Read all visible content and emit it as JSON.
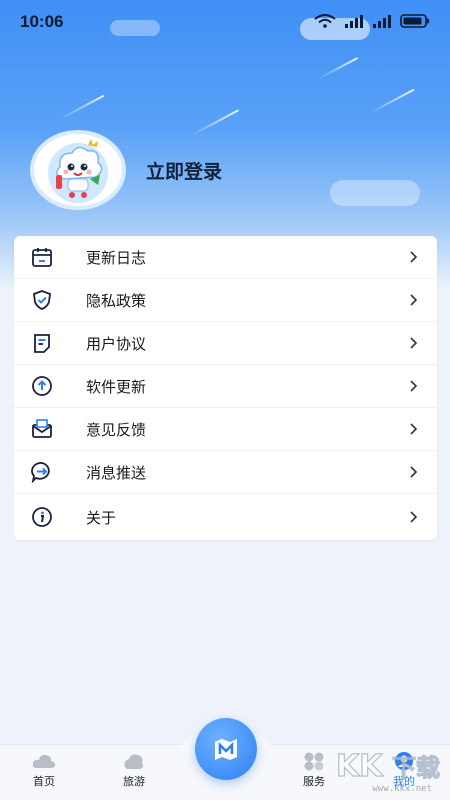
{
  "status_bar": {
    "time": "10:06"
  },
  "profile": {
    "login_label": "立即登录"
  },
  "menu": {
    "items": [
      {
        "icon": "calendar-icon",
        "label": "更新日志"
      },
      {
        "icon": "shield-check-icon",
        "label": "隐私政策"
      },
      {
        "icon": "document-icon",
        "label": "用户协议"
      },
      {
        "icon": "upload-arrow-icon",
        "label": "软件更新"
      },
      {
        "icon": "mail-icon",
        "label": "意见反馈"
      },
      {
        "icon": "message-arrow-icon",
        "label": "消息推送"
      },
      {
        "icon": "info-icon",
        "label": "关于"
      }
    ]
  },
  "bottom_nav": {
    "home": "首页",
    "travel": "旅游",
    "service": "服务",
    "mine": "我的"
  },
  "watermark": {
    "text": "KK下载",
    "url": "www.kkx.net"
  },
  "colors": {
    "accent": "#3f8ff6",
    "background": "#eef3fb"
  }
}
